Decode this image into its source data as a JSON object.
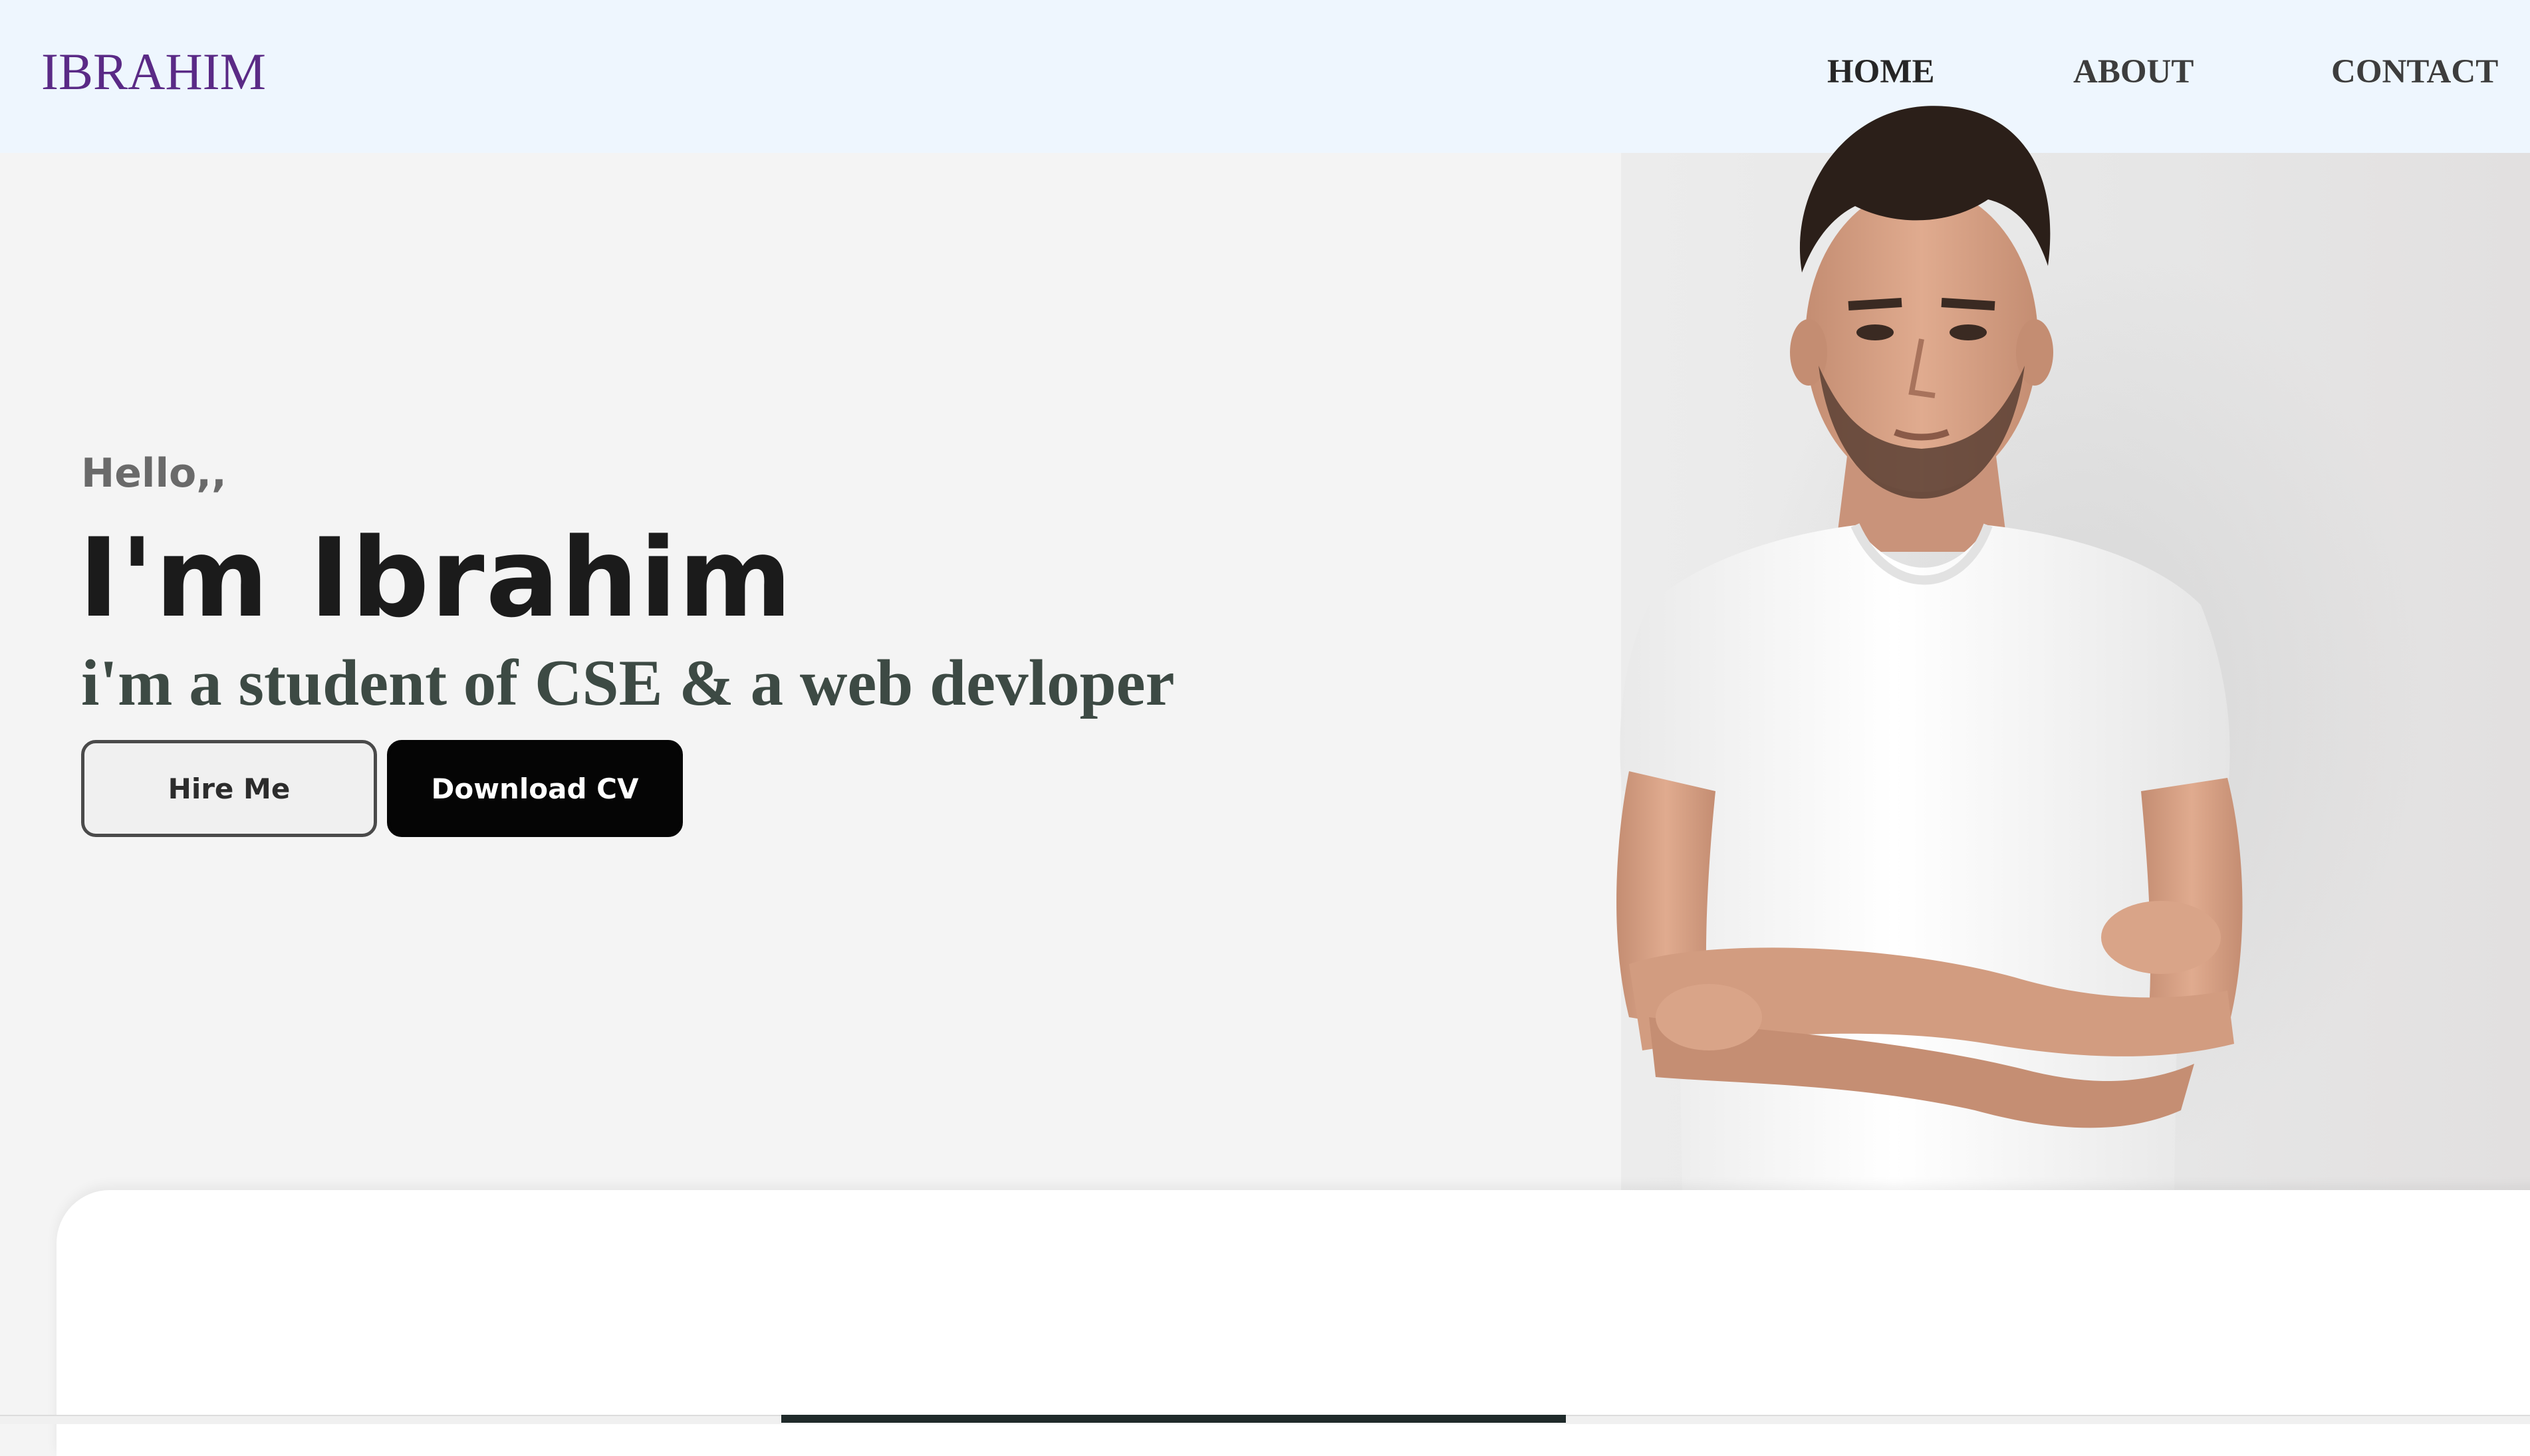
{
  "header": {
    "logo": "IBRAHIM",
    "nav": [
      {
        "label": "HOME"
      },
      {
        "label": "ABOUT"
      },
      {
        "label": "CONTACT"
      }
    ]
  },
  "hero": {
    "greeting": "Hello,,",
    "name": "I'm Ibrahim",
    "subtitle": "i'm a student of CSE & a web devloper",
    "buttons": {
      "hire": "Hire Me",
      "download_cv": "Download CV"
    }
  },
  "colors": {
    "header_bg": "#eef6fe",
    "logo": "#5a2a86",
    "hero_bg": "#f4f4f4",
    "primary_button": "#050505"
  }
}
